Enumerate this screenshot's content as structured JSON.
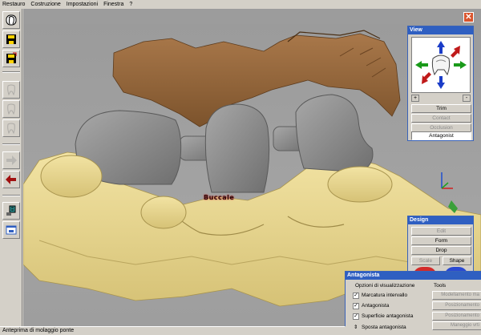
{
  "menu": [
    "Restauro",
    "Costruzione",
    "Impostazioni",
    "Finestra",
    "?"
  ],
  "viewport": {
    "label": "Buccale",
    "close_glyph": "✕"
  },
  "icons": {
    "toolbar": [
      "tooth-layers-icon",
      "save-icon",
      "save-as-icon",
      "tooth-outline-icon",
      "tooth-outline-icon",
      "tooth-outline-icon",
      "arrow-right-icon",
      "arrow-left-icon",
      "plug-icon",
      "window-icon"
    ]
  },
  "view_panel": {
    "title": "View",
    "plus": "+",
    "minus": "-",
    "buttons": [
      {
        "label": "Trim",
        "state": "enabled"
      },
      {
        "label": "Contact",
        "state": "disabled"
      },
      {
        "label": "Occlusion",
        "state": "disabled"
      },
      {
        "label": "Antagonist",
        "state": "active"
      }
    ]
  },
  "design_panel": {
    "title": "Design",
    "edit": "Edit",
    "form": "Form",
    "drop": "Drop",
    "scale": "Scale",
    "shape": "Shape"
  },
  "antagonista": {
    "title": "Antagonista",
    "options_group": "Opzioni di visualizzazione",
    "tools_group": "Tools",
    "options": [
      {
        "label": "Marcatura intervallo",
        "checked": true
      },
      {
        "label": "Antagonista",
        "checked": true
      },
      {
        "label": "Superficie antagonista",
        "checked": true
      }
    ],
    "move_label": "Sposta antagonista",
    "tools": [
      "Modellamento ma",
      "Posizionamento",
      "Posizionamento",
      "Maneggio vrti"
    ]
  },
  "status": {
    "text": "Anteprima di molaggio ponte"
  },
  "colors": {
    "model": "#e6d48f",
    "antagonist": "#9b6a3c",
    "crown": "#8f8f8f",
    "title_bar": "#2f5fc1",
    "close": "#d9542c"
  }
}
